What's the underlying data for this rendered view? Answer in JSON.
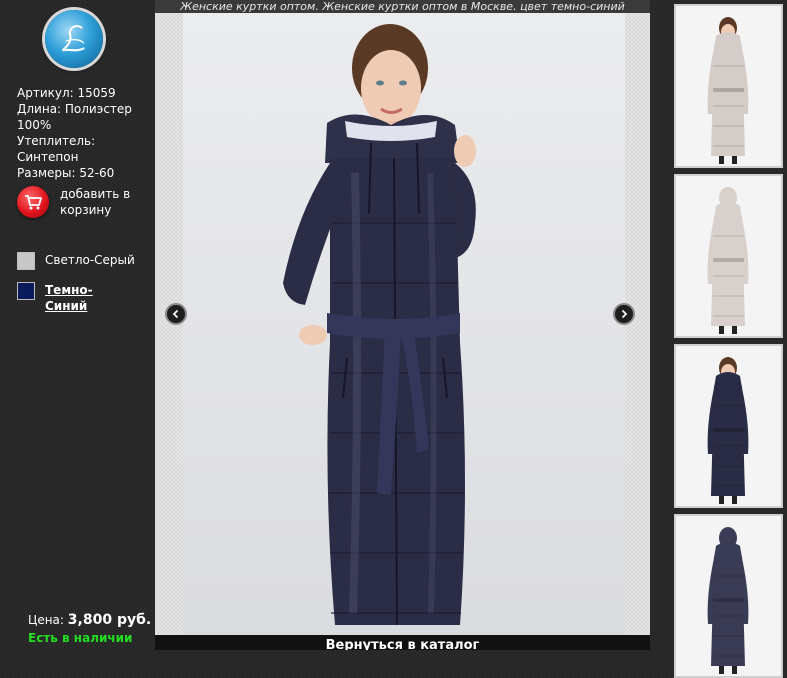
{
  "sidebar": {
    "logo_icon": "script-L-logo",
    "info_lines": [
      "Артикул: 15059",
      "Длина: Полиэстер 100%",
      "Утеплитель:",
      "Синтепон",
      "Размеры: 52-60"
    ],
    "cart_label": "добавить в корзину",
    "colors": [
      {
        "label": "Светло-Серый",
        "swatch": "#c8c8c8",
        "selected": false
      },
      {
        "label": "Темно-Синий",
        "swatch": "#0a1a5a",
        "selected": true
      }
    ],
    "price_label": "Цена:",
    "price_value": "3,800 руб.",
    "stock": "Есть в наличии"
  },
  "main": {
    "caption": "Женские куртки оптом. Женские куртки оптом в Москве. цвет темно-синий",
    "back_label": "Вернуться в каталог",
    "prev_icon": "chevron-left-icon",
    "next_icon": "chevron-right-icon"
  },
  "thumbnails": [
    {
      "coat_color": "#d4ccc8",
      "view": "front"
    },
    {
      "coat_color": "#d8d0cc",
      "view": "back"
    },
    {
      "coat_color": "#2a2b44",
      "view": "front"
    },
    {
      "coat_color": "#3a3b55",
      "view": "back"
    }
  ],
  "colors": {
    "accent_green": "#22dd22",
    "coat_navy": "#2b2c45"
  }
}
